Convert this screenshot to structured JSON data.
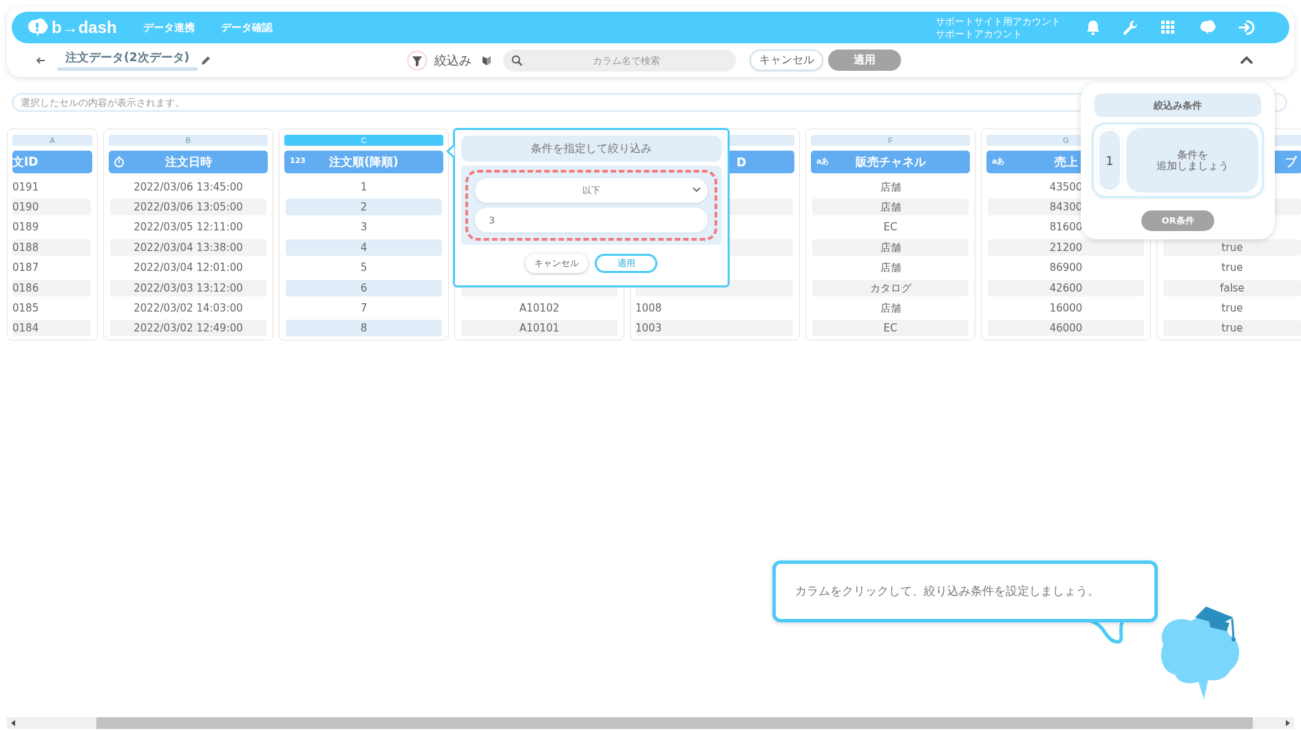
{
  "header": {
    "logo": "b→dash",
    "nav": [
      {
        "label": "データ連携"
      },
      {
        "label": "データ確認"
      }
    ],
    "account": [
      "サポートサイト用アカウント",
      "サポートアカウント"
    ]
  },
  "toolbar": {
    "title": "注文データ(2次データ)",
    "filter_label": "絞込み",
    "search": {
      "placeholder": "カラム名で検索"
    },
    "buttons": [
      {
        "label": "キャンセル",
        "kind": "outline"
      },
      {
        "label": "適用",
        "kind": "disabled"
      }
    ]
  },
  "cell_view": {
    "placeholder": "選択したセルの内容が表示されます。"
  },
  "columns": [
    {
      "letter": "A",
      "selected": false,
      "kind": "cut_left",
      "header": "文ID",
      "rows": [
        "0191",
        "0190",
        "0189",
        "0188",
        "0187",
        "0186",
        "0185",
        "0184"
      ]
    },
    {
      "letter": "B",
      "selected": false,
      "kind": "datetime",
      "header": "注文日時",
      "rows": [
        "2022/03/06 13:45:00",
        "2022/03/06 13:05:00",
        "2022/03/05 12:11:00",
        "2022/03/04 13:38:00",
        "2022/03/04 12:01:00",
        "2022/03/03 13:12:00",
        "2022/03/02 14:03:00",
        "2022/03/02 12:49:00"
      ]
    },
    {
      "letter": "C",
      "selected": true,
      "kind": "labeled",
      "type_label": "123",
      "header": "注文順(降順)",
      "rows": [
        "1",
        "2",
        "3",
        "4",
        "5",
        "6",
        "7",
        "8"
      ]
    },
    {
      "selected": false,
      "kind": "hidden",
      "rows": [
        null,
        null,
        null,
        null,
        null,
        null,
        "A10102",
        "A10101"
      ]
    },
    {
      "selected": false,
      "kind": "cut_left",
      "header": "D",
      "rows": [
        null,
        null,
        null,
        null,
        null,
        null,
        "1008",
        "1003"
      ]
    },
    {
      "letter": "F",
      "selected": false,
      "kind": "labeled",
      "type_label": "aあ",
      "header": "販売チャネル",
      "rows": [
        "店舗",
        "店舗",
        "EC",
        "店舗",
        "店舗",
        "カタログ",
        "店舗",
        "EC"
      ]
    },
    {
      "letter": "G",
      "selected": false,
      "kind": "labeled",
      "type_label": "aあ",
      "header": "売上",
      "rows": [
        "43500",
        "84300",
        "81600",
        "21200",
        "86900",
        "42600",
        "16000",
        "46000"
      ]
    },
    {
      "selected": false,
      "kind": "cut_right",
      "header": "ブ",
      "rows": [
        null,
        null,
        null,
        "true",
        "true",
        "false",
        "true",
        "true"
      ]
    }
  ],
  "filter_popup": {
    "title": "条件を指定して絞り込み",
    "operator": "以下",
    "value": "3",
    "highlighted": true,
    "buttons": [
      {
        "label": "キャンセル",
        "kind": "plain"
      },
      {
        "label": "適用",
        "kind": "primary"
      }
    ]
  },
  "conditions_panel": {
    "title": "絞込み条件",
    "groups": [
      {
        "number": "1",
        "text_lines": [
          "条件を",
          "追加しましょう"
        ]
      }
    ],
    "or_button": {
      "label": "OR条件",
      "disabled": true
    }
  },
  "help_bubble": {
    "text": "カラムをクリックして、絞り込み条件を設定しましょう。"
  }
}
